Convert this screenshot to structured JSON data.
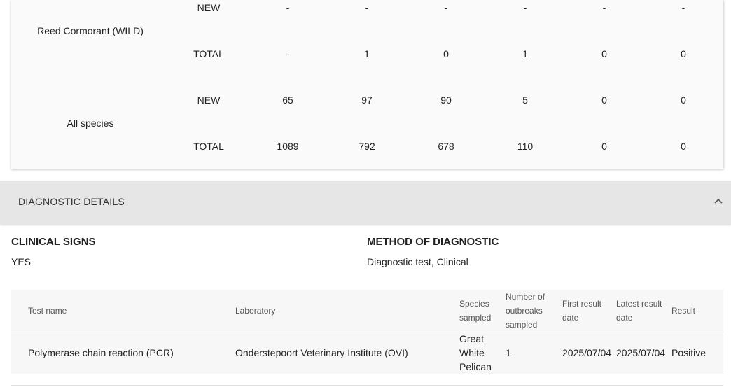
{
  "species_table": {
    "rows": [
      {
        "species": "Reed Cormorant (WILD)",
        "lines": [
          {
            "label": "NEW",
            "values": [
              "-",
              "-",
              "-",
              "-",
              "-",
              "-"
            ]
          },
          {
            "label": "TOTAL",
            "values": [
              "-",
              "1",
              "0",
              "1",
              "0",
              "0"
            ]
          }
        ]
      },
      {
        "species": "All species",
        "lines": [
          {
            "label": "NEW",
            "values": [
              "65",
              "97",
              "90",
              "5",
              "0",
              "0"
            ]
          },
          {
            "label": "TOTAL",
            "values": [
              "1089",
              "792",
              "678",
              "110",
              "0",
              "0"
            ]
          }
        ]
      }
    ]
  },
  "diagnostic": {
    "section_title": "DIAGNOSTIC DETAILS",
    "clinical_signs_heading": "CLINICAL SIGNS",
    "clinical_signs_value": "YES",
    "method_heading": "METHOD OF DIAGNOSTIC",
    "method_value": "Diagnostic test, Clinical"
  },
  "tests": {
    "headers": {
      "test_name": "Test name",
      "laboratory": "Laboratory",
      "species_sampled": [
        "Species",
        "sampled"
      ],
      "outbreaks_sampled": [
        "Number of",
        "outbreaks",
        "sampled"
      ],
      "first_result": [
        "First result",
        "date"
      ],
      "latest_result": [
        "Latest result",
        "date"
      ],
      "result": "Result"
    },
    "rows": [
      {
        "test_name": "Polymerase chain reaction (PCR)",
        "laboratory": "Onderstepoort Veterinary Institute (OVI)",
        "species": [
          "Great",
          "White",
          "Pelican"
        ],
        "outbreaks": "1",
        "first_result": "2025/07/04",
        "latest_result": "2025/07/04",
        "result": "Positive"
      }
    ]
  }
}
